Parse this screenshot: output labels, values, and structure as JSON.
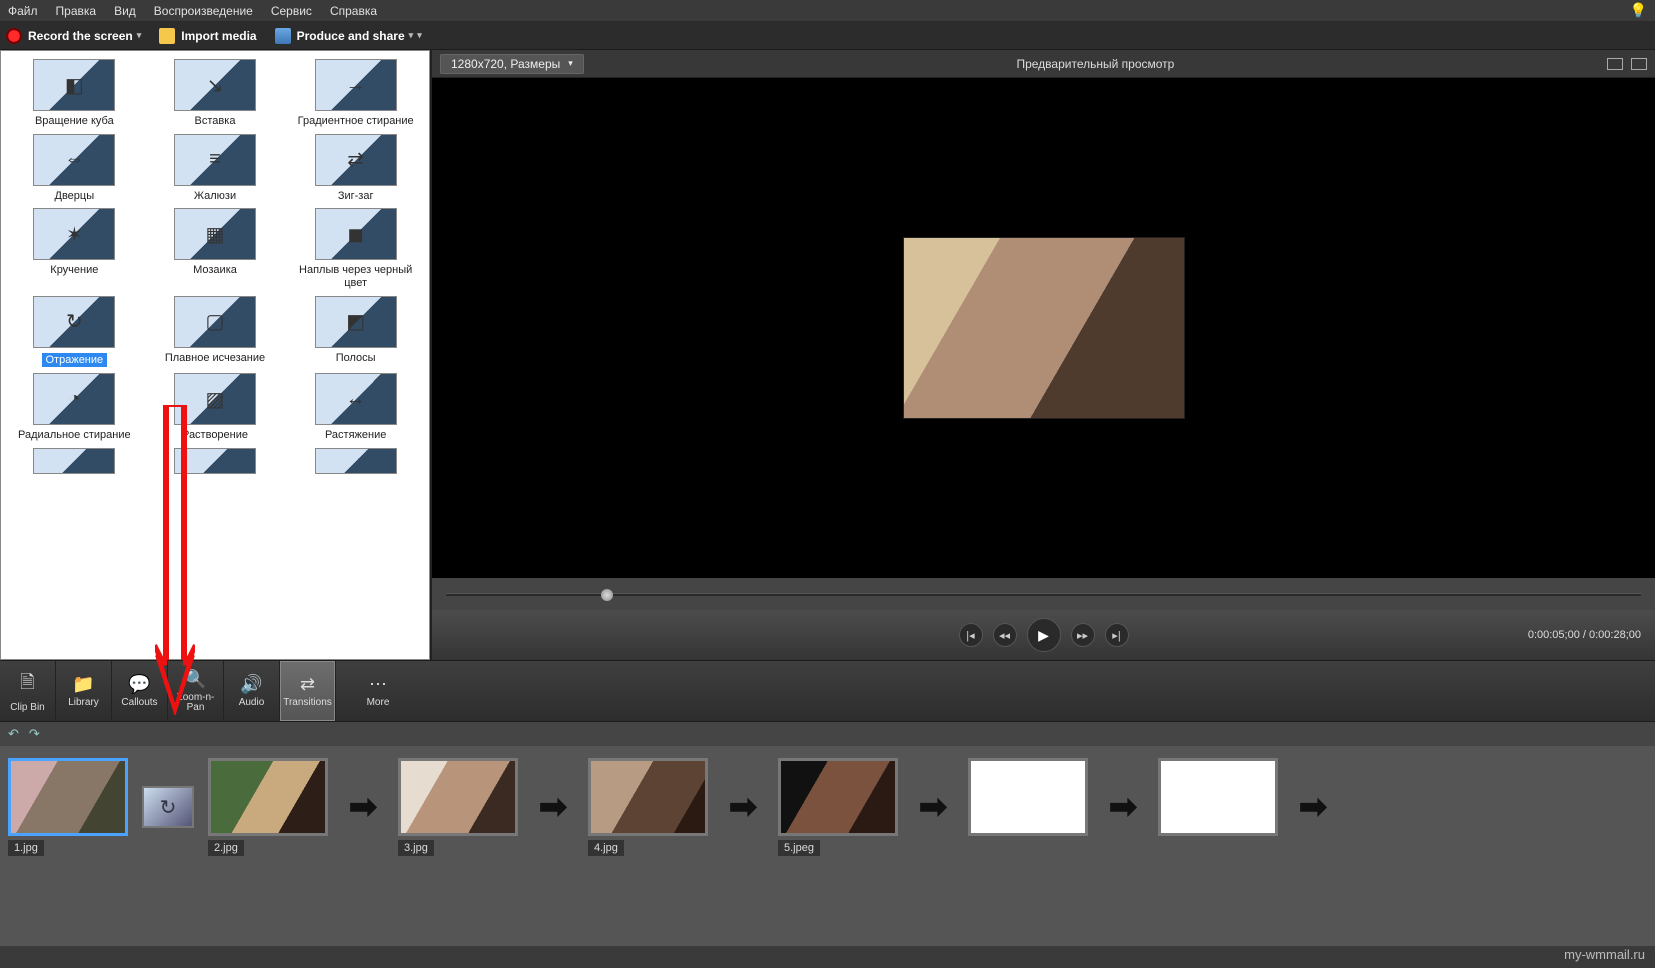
{
  "menubar": [
    "Файл",
    "Правка",
    "Вид",
    "Воспроизведение",
    "Сервис",
    "Справка"
  ],
  "actionbar": {
    "record": "Record the screen",
    "import": "Import media",
    "produce": "Produce and share"
  },
  "preview": {
    "size_label": "1280x720, Размеры",
    "title": "Предварительный просмотр",
    "timecode": "0:00:05;00 / 0:00:28;00"
  },
  "transitions": [
    {
      "label": "Вращение куба"
    },
    {
      "label": "Вставка"
    },
    {
      "label": "Градиентное стирание"
    },
    {
      "label": "Дверцы"
    },
    {
      "label": "Жалюзи"
    },
    {
      "label": "Зиг-заг"
    },
    {
      "label": "Кручение"
    },
    {
      "label": "Мозаика"
    },
    {
      "label": "Наплыв через черный цвет"
    },
    {
      "label": "Отражение",
      "selected": true
    },
    {
      "label": "Плавное исчезание"
    },
    {
      "label": "Полосы"
    },
    {
      "label": "Радиальное стирание"
    },
    {
      "label": "Растворение"
    },
    {
      "label": "Растяжение"
    }
  ],
  "tooltabs": [
    {
      "label": "Clip Bin"
    },
    {
      "label": "Library"
    },
    {
      "label": "Callouts"
    },
    {
      "label": "Zoom-n-Pan"
    },
    {
      "label": "Audio"
    },
    {
      "label": "Transitions",
      "active": true
    },
    {
      "label": "More",
      "more": true
    }
  ],
  "timeline": {
    "clips": [
      {
        "label": "1.jpg",
        "type": "image",
        "variant": "v1",
        "first": true
      },
      {
        "type": "transition"
      },
      {
        "label": "2.jpg",
        "type": "image",
        "variant": "v2"
      },
      {
        "type": "arrow"
      },
      {
        "label": "3.jpg",
        "type": "image",
        "variant": "v3"
      },
      {
        "type": "arrow"
      },
      {
        "label": "4.jpg",
        "type": "image",
        "variant": "v4"
      },
      {
        "type": "arrow"
      },
      {
        "label": "5.jpeg",
        "type": "image",
        "variant": "v5"
      },
      {
        "type": "arrow"
      },
      {
        "type": "blank"
      },
      {
        "type": "arrow"
      },
      {
        "type": "blank"
      },
      {
        "type": "arrow"
      }
    ]
  },
  "watermark": "my-wmmail.ru"
}
